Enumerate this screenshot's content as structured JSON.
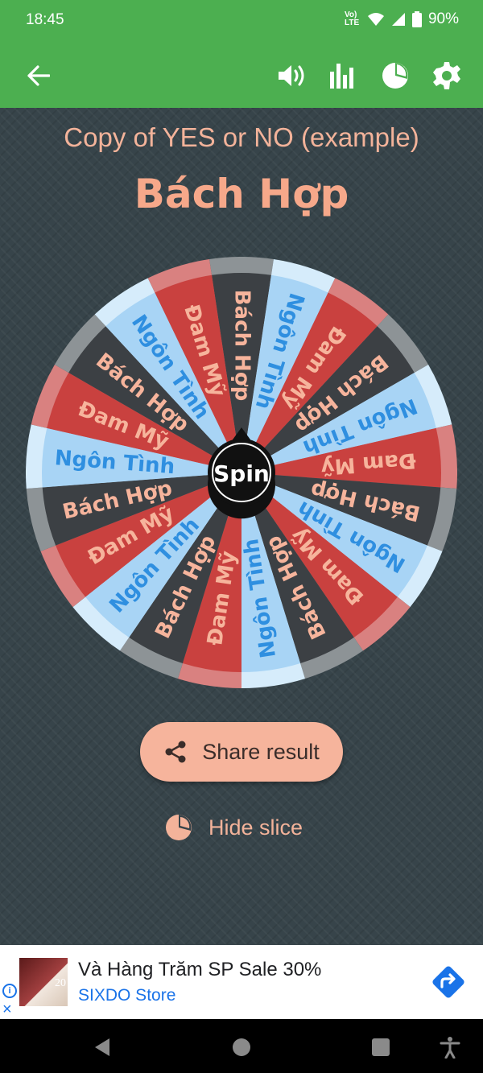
{
  "status_bar": {
    "time": "18:45",
    "battery": "90%",
    "network_label": "Vo) LTE",
    "icons": [
      "volte-icon",
      "wifi-icon",
      "signal-icon",
      "battery-icon"
    ]
  },
  "app_bar": {
    "icons": [
      "back-arrow-icon",
      "volume-icon",
      "bar-chart-icon",
      "pie-chart-icon",
      "gear-icon"
    ],
    "color": "#4caf50"
  },
  "wheel": {
    "title": "Copy of YES or NO (example)",
    "result": "Bách Hợp",
    "spin_label": "Spin",
    "slices": [
      {
        "label": "Bách Hợp",
        "color": "#3c4044",
        "text_color": "#f6b49c"
      },
      {
        "label": "Ngôn Tình",
        "color": "#a8d4f5",
        "text_color": "#2f8fe0"
      },
      {
        "label": "Đam Mỹ",
        "color": "#c9413f",
        "text_color": "#f6b49c"
      },
      {
        "label": "Bách Hợp",
        "color": "#3c4044",
        "text_color": "#f6b49c"
      },
      {
        "label": "Ngôn Tình",
        "color": "#a8d4f5",
        "text_color": "#2f8fe0"
      },
      {
        "label": "Đam Mỹ",
        "color": "#c9413f",
        "text_color": "#f6b49c"
      },
      {
        "label": "Bách Hợp",
        "color": "#3c4044",
        "text_color": "#f6b49c"
      },
      {
        "label": "Ngôn Tình",
        "color": "#a8d4f5",
        "text_color": "#2f8fe0"
      },
      {
        "label": "Đam Mỹ",
        "color": "#c9413f",
        "text_color": "#f6b49c"
      },
      {
        "label": "Bách Hợp",
        "color": "#3c4044",
        "text_color": "#f6b49c"
      },
      {
        "label": "Ngôn Tình",
        "color": "#a8d4f5",
        "text_color": "#2f8fe0"
      },
      {
        "label": "Đam Mỹ",
        "color": "#c9413f",
        "text_color": "#f6b49c"
      },
      {
        "label": "Bách Hợp",
        "color": "#3c4044",
        "text_color": "#f6b49c"
      },
      {
        "label": "Ngôn Tình",
        "color": "#a8d4f5",
        "text_color": "#2f8fe0"
      },
      {
        "label": "Đam Mỹ",
        "color": "#c9413f",
        "text_color": "#f6b49c"
      },
      {
        "label": "Bách Hợp",
        "color": "#3c4044",
        "text_color": "#f6b49c"
      },
      {
        "label": "Ngôn Tình",
        "color": "#a8d4f5",
        "text_color": "#2f8fe0"
      },
      {
        "label": "Đam Mỹ",
        "color": "#c9413f",
        "text_color": "#f6b49c"
      },
      {
        "label": "Bách Hợp",
        "color": "#3c4044",
        "text_color": "#f6b49c"
      },
      {
        "label": "Ngôn Tình",
        "color": "#a8d4f5",
        "text_color": "#2f8fe0"
      },
      {
        "label": "Đam Mỹ",
        "color": "#c9413f",
        "text_color": "#f6b49c"
      }
    ]
  },
  "actions": {
    "share_label": "Share result",
    "hide_slice_label": "Hide slice"
  },
  "ad": {
    "title": "Và Hàng Trăm SP Sale 30%",
    "source": "SIXDO Store",
    "thumb_badge": "20"
  }
}
